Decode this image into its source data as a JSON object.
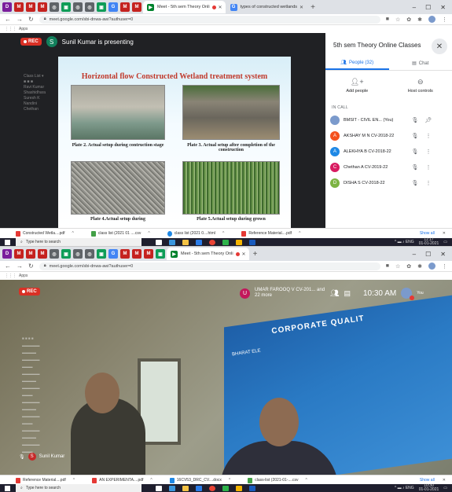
{
  "shot1": {
    "tabs": [
      {
        "label": "Meet - 5th sem Theory Onli",
        "active": true
      },
      {
        "label": "types of constructed wetlands",
        "active": false
      }
    ],
    "url": "meet.google.com/sbi-dnwa-awi?authuser=0",
    "bookmarks_label": "Apps",
    "rec_label": "REC",
    "presenter_initial": "S",
    "presenter_text": "Sunil Kumar is presenting",
    "slide": {
      "title": "Horizontal flow  Constructed Wetland treatment system",
      "captions": [
        "Plate 2. Actual setup during contruction stage",
        "Plate 3. Actual setup after completion of the construction",
        "Plate 4.Actual setup during",
        "Plate 5.Actual setup during grown"
      ]
    },
    "panel": {
      "title": "5th sem Theory Online Classes",
      "tab_people": "People (32)",
      "tab_chat": "Chat",
      "add_people": "Add people",
      "host_controls": "Host controls",
      "in_call": "IN CALL",
      "people": [
        {
          "initial": "",
          "name": "BMSIT - CIVIL EN...",
          "you": "(You)",
          "color": "#7b9acc"
        },
        {
          "initial": "A",
          "name": "AKSHAY M N CV-2018-22",
          "you": "",
          "color": "#f4511e"
        },
        {
          "initial": "A",
          "name": "ALEKHYA B CV-2018-22",
          "you": "",
          "color": "#1e88e5"
        },
        {
          "initial": "C",
          "name": "Chethan A CV-2019-22",
          "you": "",
          "color": "#d81b60"
        },
        {
          "initial": "D",
          "name": "DISHA S CV-2018-22",
          "you": "",
          "color": "#7cb342"
        }
      ]
    },
    "downloads": [
      {
        "label": "Constructed Wetla....pdf",
        "color": "#e53935"
      },
      {
        "label": "class list (2021 01 ....csv",
        "color": "#43a047"
      },
      {
        "label": "class list (2021 0....html",
        "color": "#1e88e5"
      },
      {
        "label": "Reference Material....pdf",
        "color": "#e53935"
      }
    ],
    "show_all": "Show all",
    "taskbar_search": "Type here to search",
    "tray_time": "11:17",
    "tray_date": "01-01-2021"
  },
  "shot2": {
    "tabs": [
      {
        "label": "Meet - 5th sem Theory Onli",
        "active": true
      }
    ],
    "url": "meet.google.com/sbi-dnwa-awi?authuser=0",
    "bookmarks_label": "Apps",
    "rec_label": "REC",
    "banner_text": "CORPORATE QUALIT",
    "banner_sub": "BHARAT ELE",
    "joiner_initial": "U",
    "joiner_text": "UMAR FAROOQ V CV-201... and 22 more",
    "clock": "10:30 AM",
    "you_label": "You",
    "name_tag_initial": "S",
    "name_tag": "Sunil Kumar",
    "downloads": [
      {
        "label": "Reference Material....pdf",
        "color": "#e53935"
      },
      {
        "label": "AN EXPERIMENTA....pdf",
        "color": "#e53935"
      },
      {
        "label": "16CV53_DRC_CV....docx",
        "color": "#1e88e5"
      },
      {
        "label": "class-list (2021-01-....csv",
        "color": "#43a047"
      }
    ],
    "show_all": "Show all",
    "taskbar_search": "Type here to search",
    "tray_time": "10:30",
    "tray_date": "01-01-2021"
  },
  "colors": {
    "meet_bg": "#202124",
    "rec_red": "#d93025",
    "accent_blue": "#1a73e8"
  }
}
